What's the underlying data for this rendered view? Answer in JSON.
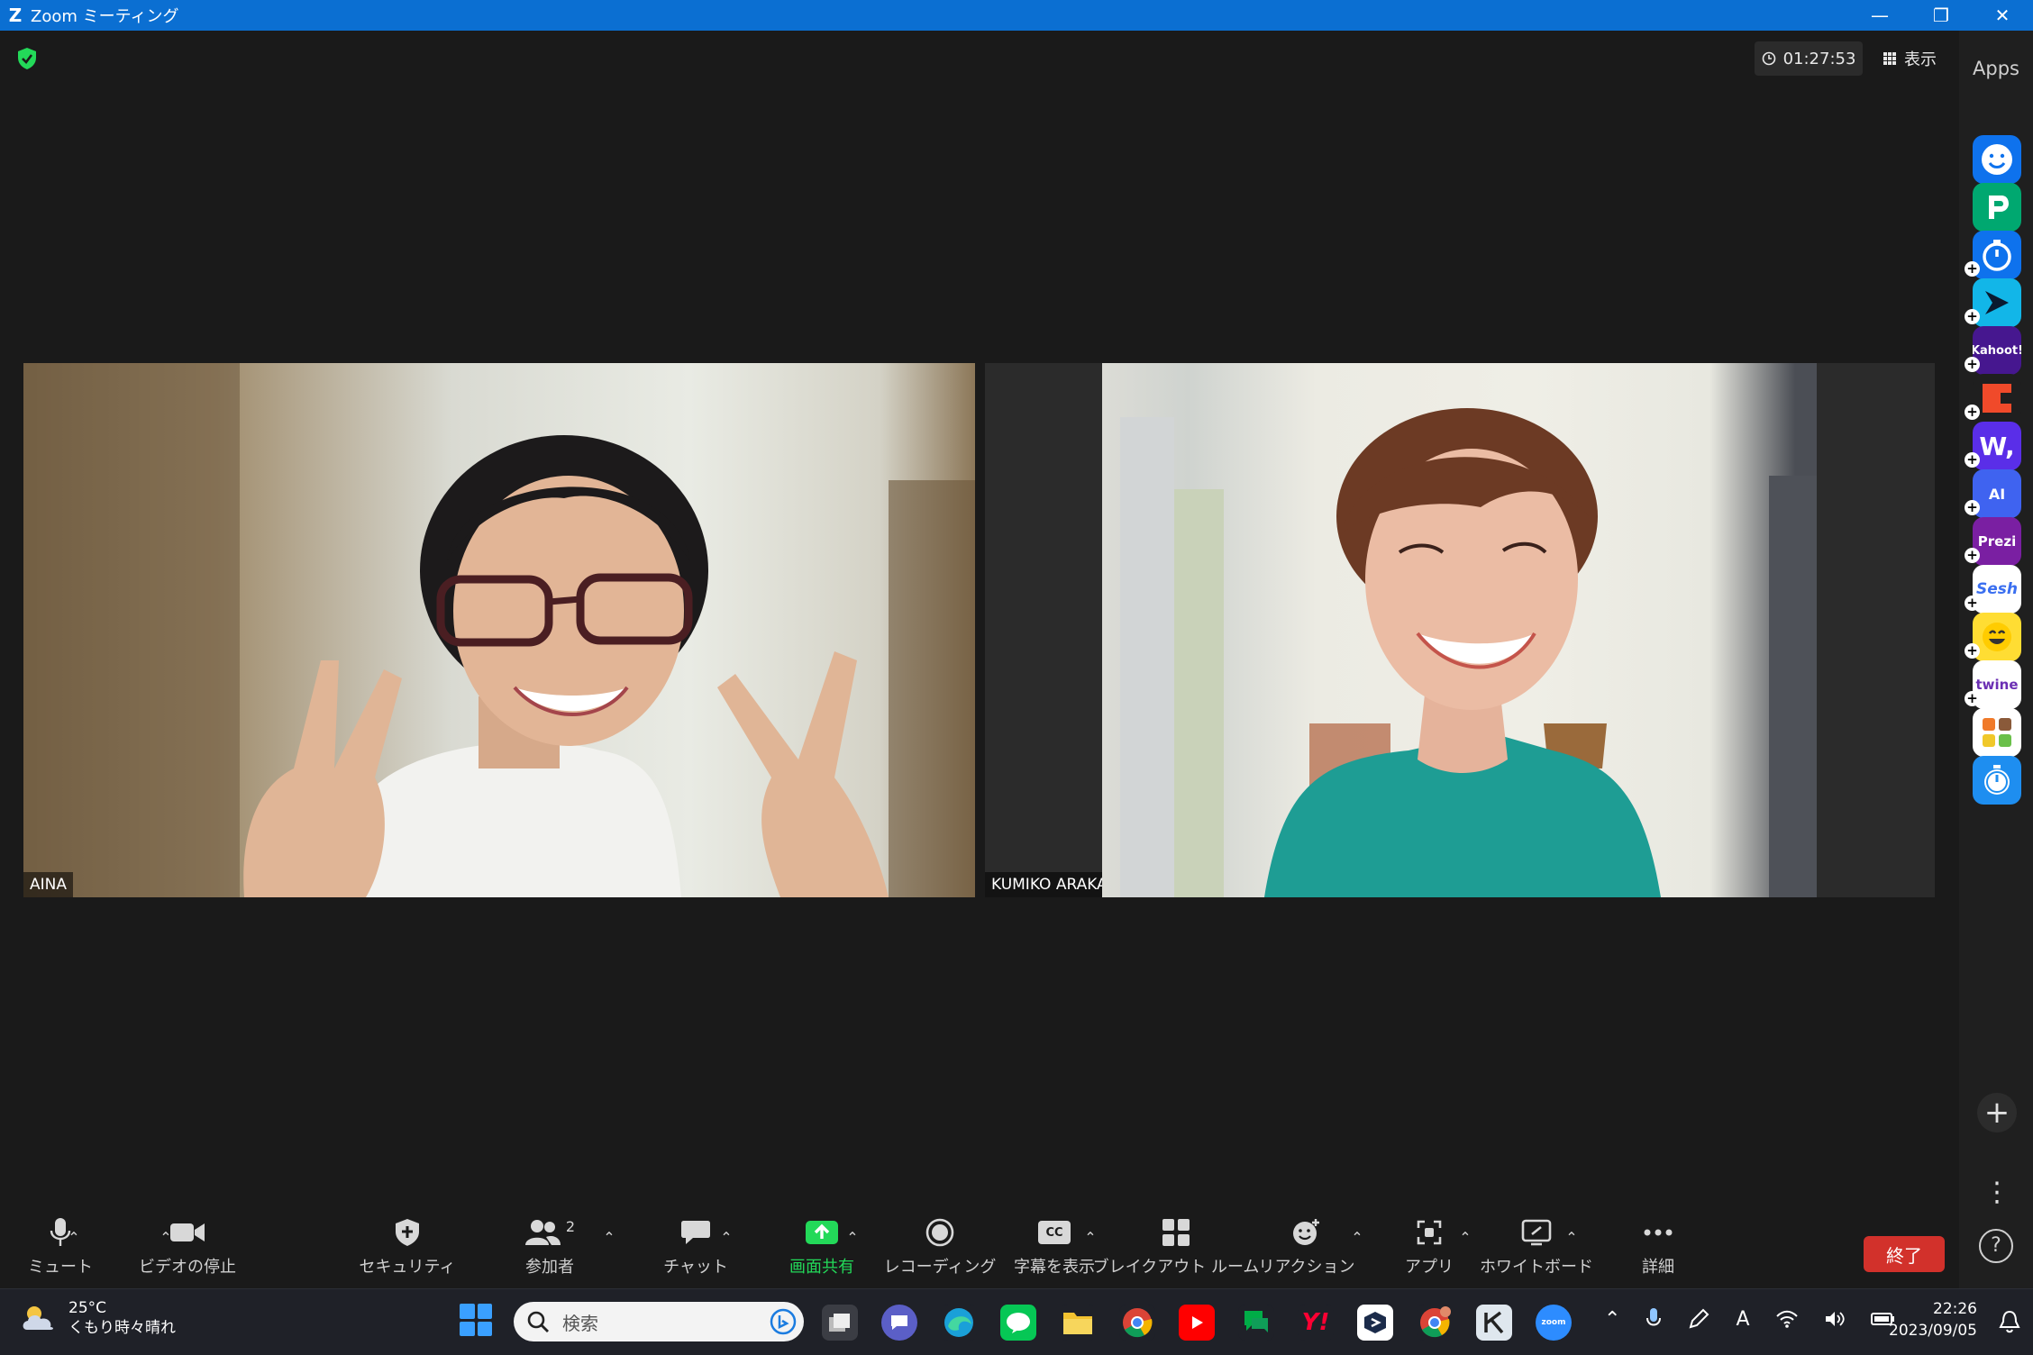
{
  "window": {
    "app_logo_letter": "Z",
    "title": "Zoom ミーティング",
    "controls": [
      "minimize",
      "restore",
      "close"
    ]
  },
  "meeting": {
    "timer": "01:27:53",
    "view_label": "表示",
    "participants": [
      {
        "name": "AINA"
      },
      {
        "name": "KUMIKO ARAKAWA"
      }
    ]
  },
  "apps_panel": {
    "title": "Apps",
    "apps": [
      {
        "name": "smile-app",
        "label": "",
        "color": "#0e72ed",
        "has_add": false
      },
      {
        "name": "p-app",
        "label": "",
        "color": "#00a870",
        "has_add": false
      },
      {
        "name": "timer-app",
        "label": "",
        "color": "#0e72ed",
        "has_add": false
      },
      {
        "name": "arrow-app",
        "label": "",
        "color": "#12b6e8",
        "has_add": true
      },
      {
        "name": "kahoot-app",
        "label": "Kahoot!",
        "color": "#46178f",
        "has_add": true
      },
      {
        "name": "c-app",
        "label": "",
        "color": "#f04a2a",
        "has_add": true
      },
      {
        "name": "w-app",
        "label": "W,",
        "color": "#5a2ee8",
        "has_add": true
      },
      {
        "name": "ai-app",
        "label": "AI",
        "color": "#3f63f0",
        "has_add": true
      },
      {
        "name": "prezi-app",
        "label": "Prezi",
        "color": "#7a1fa2",
        "has_add": true
      },
      {
        "name": "sesh-app",
        "label": "Sesh",
        "color": "#ffffff",
        "has_add": true
      },
      {
        "name": "emoji-app",
        "label": "",
        "color": "#ffdd33",
        "has_add": true
      },
      {
        "name": "twine-app",
        "label": "twine",
        "color": "#ffffff",
        "has_add": true
      },
      {
        "name": "blocks-app",
        "label": "",
        "color": "#ffffff",
        "has_add": true
      },
      {
        "name": "stopwatch-app",
        "label": "",
        "color": "#1e8ef0",
        "has_add": false
      }
    ]
  },
  "toolbar": {
    "mute": "ミュート",
    "video": "ビデオの停止",
    "security": "セキュリティ",
    "participants": "参加者",
    "participants_count": "2",
    "chat": "チャット",
    "share": "画面共有",
    "record": "レコーディング",
    "captions": "字幕を表示",
    "cc": "CC",
    "breakout": "ブレイクアウト ルーム",
    "reactions": "リアクション",
    "apps": "アプリ",
    "whiteboard": "ホワイトボード",
    "more": "詳細",
    "end": "終了",
    "share_color": "#23d959",
    "end_color": "#d2312b"
  },
  "taskbar": {
    "temperature": "25°C",
    "weather": "くもり時々晴れ",
    "search_placeholder": "検索",
    "time": "22:26",
    "date": "2023/09/05"
  }
}
